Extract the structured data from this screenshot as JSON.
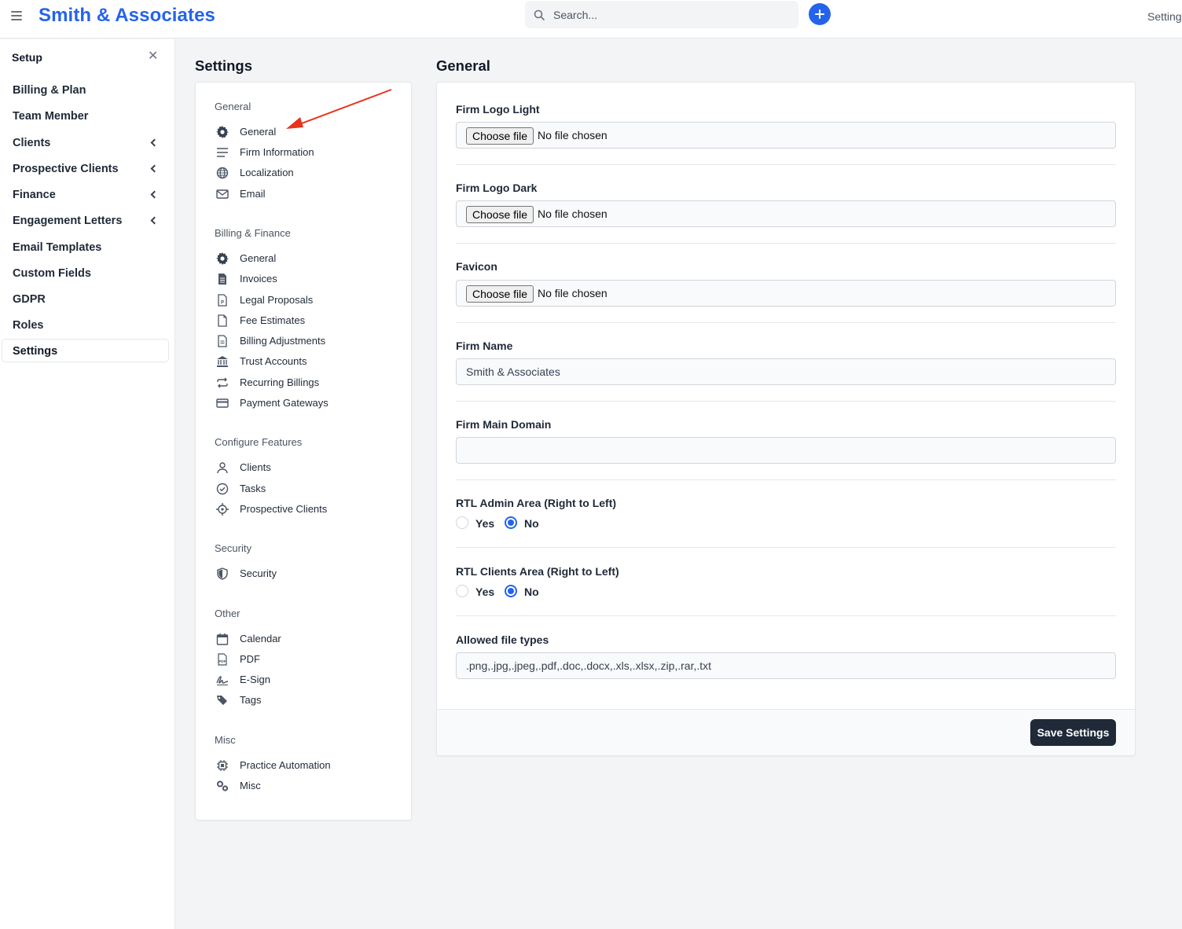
{
  "app": {
    "brand": "Smith & Associates",
    "top_right_label": "Setting"
  },
  "search": {
    "placeholder": "Search..."
  },
  "setup": {
    "title": "Setup",
    "items": [
      {
        "label": "Billing & Plan"
      },
      {
        "label": "Team Member"
      },
      {
        "label": "Clients"
      },
      {
        "label": "Prospective Clients"
      },
      {
        "label": "Finance"
      },
      {
        "label": "Engagement Letters"
      },
      {
        "label": "Email Templates"
      },
      {
        "label": "Custom Fields"
      },
      {
        "label": "GDPR"
      },
      {
        "label": "Roles"
      },
      {
        "label": "Settings"
      }
    ]
  },
  "settings_nav": {
    "heading": "Settings",
    "groups": [
      {
        "title": "General",
        "items": [
          {
            "label": "General",
            "icon": "gear-icon"
          },
          {
            "label": "Firm Information",
            "icon": "lines-icon"
          },
          {
            "label": "Localization",
            "icon": "globe-icon"
          },
          {
            "label": "Email",
            "icon": "envelope-icon"
          }
        ]
      },
      {
        "title": "Billing & Finance",
        "items": [
          {
            "label": "General",
            "icon": "gear-icon"
          },
          {
            "label": "Invoices",
            "icon": "document-icon"
          },
          {
            "label": "Legal Proposals",
            "icon": "file-p-icon"
          },
          {
            "label": "Fee Estimates",
            "icon": "file-icon"
          },
          {
            "label": "Billing Adjustments",
            "icon": "file-text-icon"
          },
          {
            "label": "Trust Accounts",
            "icon": "bank-icon"
          },
          {
            "label": "Recurring Billings",
            "icon": "repeat-icon"
          },
          {
            "label": "Payment Gateways",
            "icon": "credit-card-icon"
          }
        ]
      },
      {
        "title": "Configure Features",
        "items": [
          {
            "label": "Clients",
            "icon": "user-icon"
          },
          {
            "label": "Tasks",
            "icon": "check-circle-icon"
          },
          {
            "label": "Prospective Clients",
            "icon": "crosshair-icon"
          }
        ]
      },
      {
        "title": "Security",
        "items": [
          {
            "label": "Security",
            "icon": "shield-icon"
          }
        ]
      },
      {
        "title": "Other",
        "items": [
          {
            "label": "Calendar",
            "icon": "calendar-icon"
          },
          {
            "label": "PDF",
            "icon": "pdf-icon"
          },
          {
            "label": "E-Sign",
            "icon": "signature-icon"
          },
          {
            "label": "Tags",
            "icon": "tags-icon"
          }
        ]
      },
      {
        "title": "Misc",
        "items": [
          {
            "label": "Practice Automation",
            "icon": "chip-icon"
          },
          {
            "label": "Misc",
            "icon": "gears-icon"
          }
        ]
      }
    ]
  },
  "form": {
    "heading": "General",
    "file_button_label": "Choose file",
    "no_file_text": "No file chosen",
    "firm_logo_light_label": "Firm Logo Light",
    "firm_logo_dark_label": "Firm Logo Dark",
    "favicon_label": "Favicon",
    "firm_name_label": "Firm Name",
    "firm_name_value": "Smith & Associates",
    "firm_main_domain_label": "Firm Main Domain",
    "firm_main_domain_value": "",
    "rtl_admin_label": "RTL Admin Area (Right to Left)",
    "rtl_clients_label": "RTL Clients Area (Right to Left)",
    "yes_label": "Yes",
    "no_label": "No",
    "rtl_admin_selected": "No",
    "rtl_clients_selected": "No",
    "allowed_types_label": "Allowed file types",
    "allowed_types_value": ".png,.jpg,.jpeg,.pdf,.doc,.docx,.xls,.xlsx,.zip,.rar,.txt",
    "save_label": "Save Settings"
  },
  "colors": {
    "brand": "#2563eb",
    "save_button": "#1f2937",
    "annotation_arrow": "#e8341c"
  }
}
